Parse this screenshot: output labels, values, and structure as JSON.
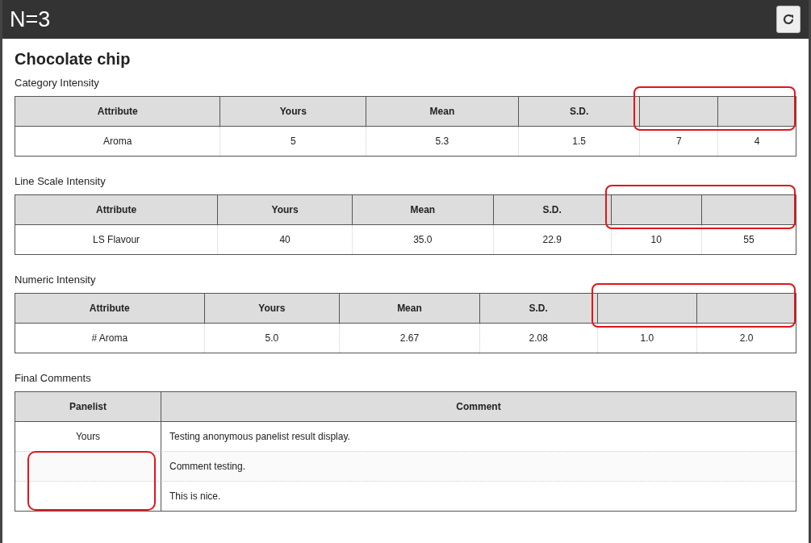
{
  "header": {
    "title": "N=3"
  },
  "product": {
    "title": "Chocolate chip"
  },
  "sections": [
    {
      "title": "Category Intensity",
      "columns": [
        "Attribute",
        "Yours",
        "Mean",
        "S.D."
      ],
      "highlight_unlabeled_columns": true,
      "rows": [
        [
          "Aroma",
          "5",
          "5.3",
          "1.5",
          "7",
          "4"
        ]
      ]
    },
    {
      "title": "Line Scale Intensity",
      "columns": [
        "Attribute",
        "Yours",
        "Mean",
        "S.D."
      ],
      "highlight_unlabeled_columns": true,
      "rows": [
        [
          "LS Flavour",
          "40",
          "35.0",
          "22.9",
          "10",
          "55"
        ]
      ]
    },
    {
      "title": "Numeric Intensity",
      "columns": [
        "Attribute",
        "Yours",
        "Mean",
        "S.D."
      ],
      "highlight_unlabeled_columns": true,
      "rows": [
        [
          "# Aroma",
          "5.0",
          "2.67",
          "2.08",
          "1.0",
          "2.0"
        ]
      ]
    }
  ],
  "comments": {
    "title": "Final Comments",
    "columns": [
      "Panelist",
      "Comment"
    ],
    "highlight_blank_panelists": true,
    "rows": [
      {
        "panelist": "Yours",
        "comment": "Testing anonymous panelist result display."
      },
      {
        "comment": "Comment testing."
      },
      {
        "comment": "This is nice."
      }
    ]
  }
}
